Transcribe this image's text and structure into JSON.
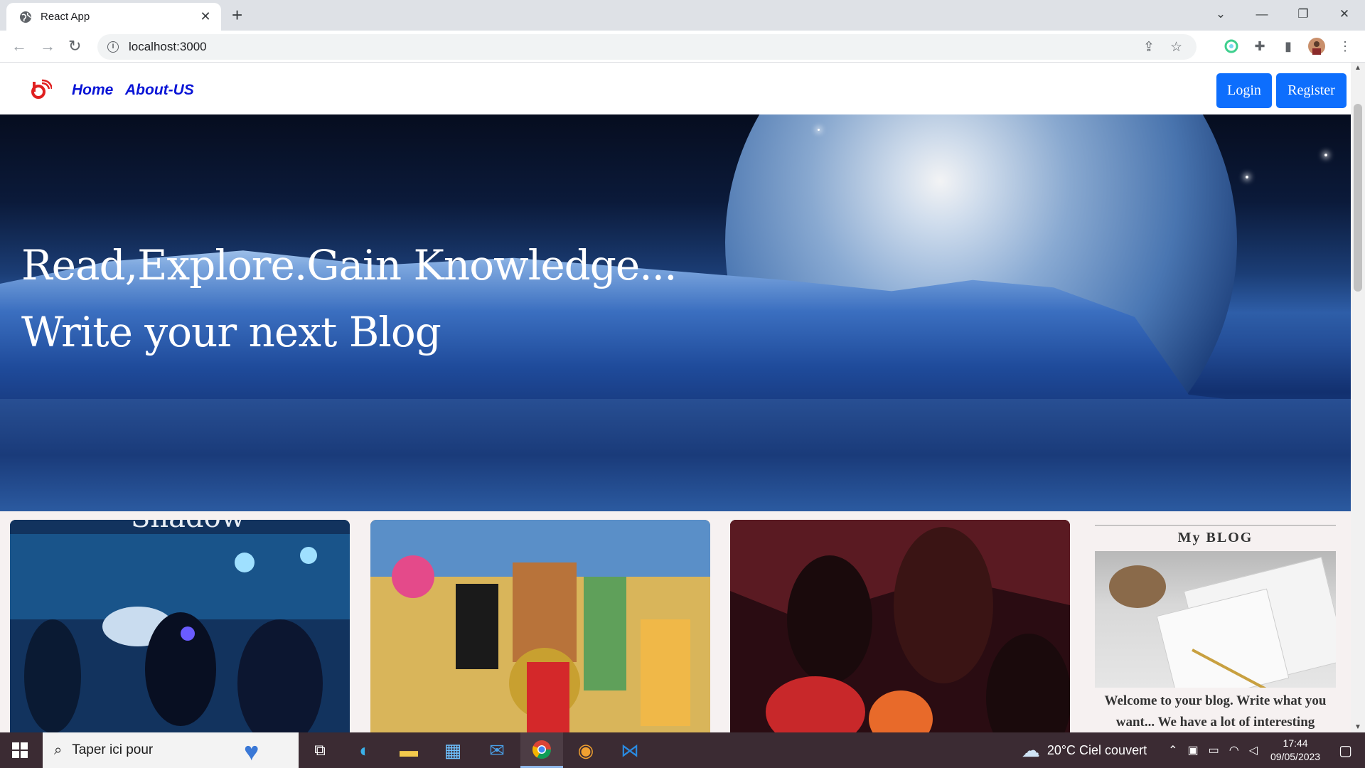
{
  "browser": {
    "tab_title": "React App",
    "tab_close": "✕",
    "new_tab": "+",
    "url": "localhost:3000",
    "win_controls": {
      "dropdown": "⌄",
      "minimize": "—",
      "restore": "❐",
      "close": "✕"
    }
  },
  "navbar": {
    "links": [
      {
        "label": "Home"
      },
      {
        "label": "About-US"
      }
    ],
    "login_label": "Login",
    "register_label": "Register"
  },
  "hero": {
    "line1": "Read,Explore.Gain Knowledge...",
    "line2": "Write your next Blog"
  },
  "cards": [
    {
      "caption_fragment": "Shadow"
    },
    {
      "caption_fragment": ""
    },
    {
      "caption_fragment": ""
    }
  ],
  "sidebar": {
    "title": "My BLOG",
    "text": "Welcome to your blog. Write what you want... We have a lot of interesting"
  },
  "taskbar": {
    "search_placeholder": "Taper ici pour",
    "weather": "20°C  Ciel couvert",
    "time": "17:44",
    "date": "09/05/2023"
  },
  "colors": {
    "nav_link": "#0a15d6",
    "button_primary": "#0d6efd",
    "page_bg": "#f6f1f1",
    "taskbar_bg": "#3b2b33"
  }
}
